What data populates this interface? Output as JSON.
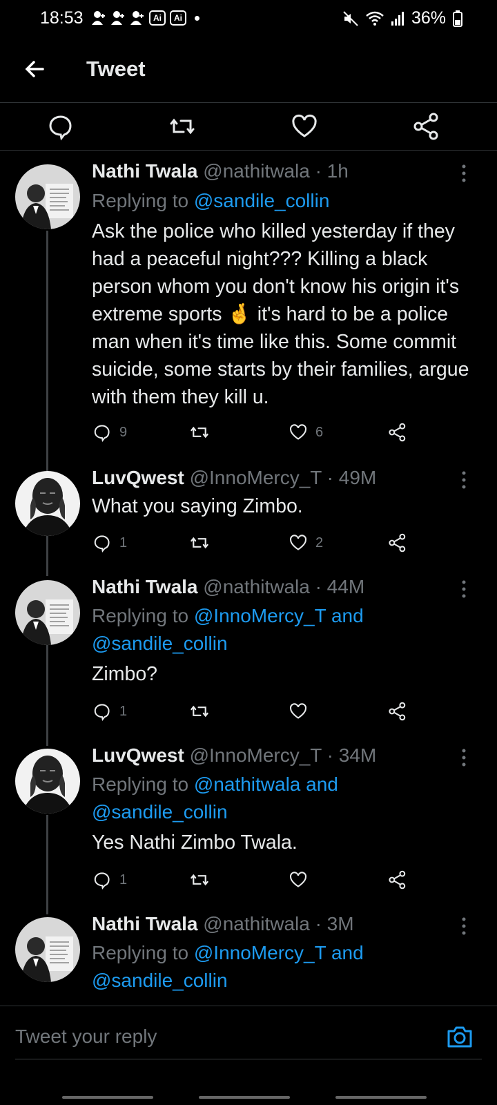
{
  "status_bar": {
    "time": "18:53",
    "ai_badge": "Ai",
    "battery": "36%"
  },
  "header": {
    "title": "Tweet"
  },
  "tweets": [
    {
      "name": "Nathi Twala",
      "meta": "@nathitwala · 1h",
      "reply_prefix": "Replying to ",
      "mention": "@sandile_collin",
      "body": "Ask the police who killed yesterday if they had a peaceful night??? Killing a black person whom you don't know his origin it's extreme sports 🤞 it's hard to be a police man when it's time like this. Some commit suicide, some starts by their families, argue with them they kill u.",
      "replies": "9",
      "likes": "6"
    },
    {
      "name": "LuvQwest",
      "meta": "@InnoMercy_T · 49M",
      "body": "What you saying Zimbo.",
      "replies": "1",
      "likes": "2"
    },
    {
      "name": "Nathi Twala",
      "meta": "@nathitwala · 44M",
      "reply_prefix": "Replying to ",
      "mention": "@InnoMercy_T and",
      "mention2": "@sandile_collin",
      "body": "Zimbo?",
      "replies": "1",
      "likes": ""
    },
    {
      "name": "LuvQwest",
      "meta": "@InnoMercy_T · 34M",
      "reply_prefix": "Replying to ",
      "mention": "@nathitwala and",
      "mention2": "@sandile_collin",
      "body": "Yes Nathi Zimbo Twala.",
      "replies": "1",
      "likes": ""
    },
    {
      "name": "Nathi Twala",
      "meta": "@nathitwala · 3M",
      "reply_prefix": "Replying to ",
      "mention": "@InnoMercy_T and",
      "mention2": "@sandile_collin"
    }
  ],
  "reply_bar": {
    "placeholder": "Tweet your reply"
  },
  "colors": {
    "background": "#000000",
    "text": "#e7e9ea",
    "muted": "#71767b",
    "accent": "#1d9bf0"
  }
}
